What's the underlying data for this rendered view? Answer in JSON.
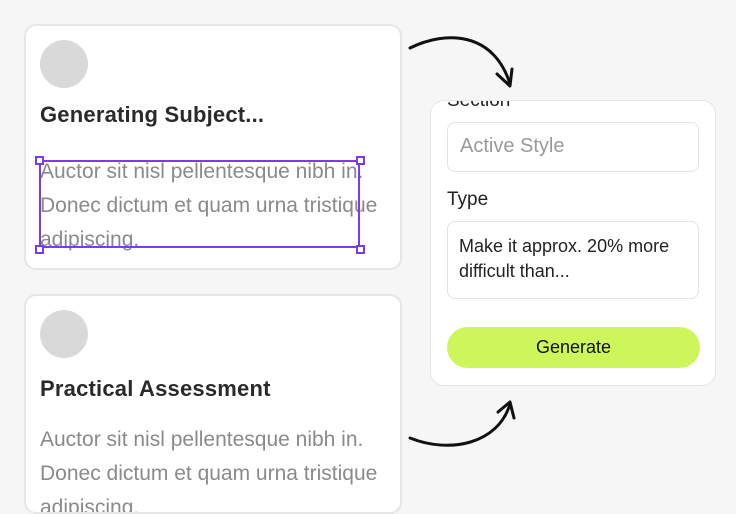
{
  "cards": [
    {
      "title": "Generating Subject...",
      "body": "Auctor sit nisl pellentesque nibh in. Donec dictum et quam urna tristique adipiscing."
    },
    {
      "title": "Practical Assessment",
      "body": "Auctor sit nisl pellentesque nibh in. Donec dictum et quam urna tristique adipiscing."
    }
  ],
  "form": {
    "section_label": "Section",
    "section_placeholder": "Active Style",
    "type_label": "Type",
    "type_value": "Make it approx. 20% more difficult than...",
    "generate_label": "Generate"
  },
  "colors": {
    "accent": "#cdf65a",
    "selection": "#7c3aed"
  },
  "icons": [
    "curved-arrow-icon"
  ]
}
